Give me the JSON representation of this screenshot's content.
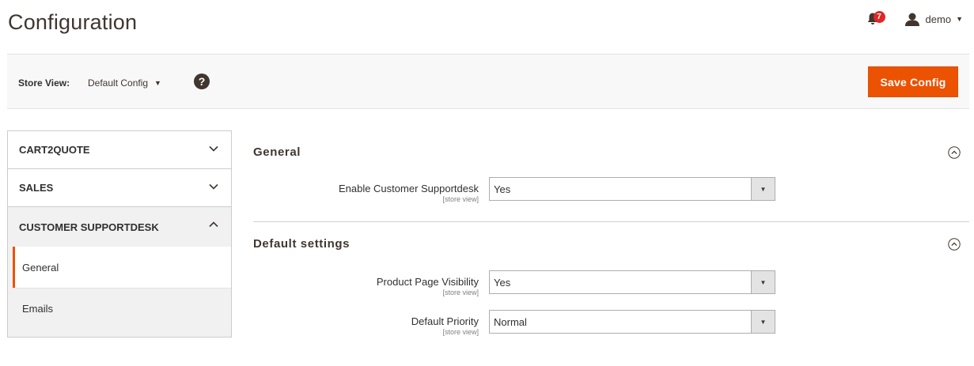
{
  "page": {
    "title": "Configuration"
  },
  "header": {
    "notifications_count": "7",
    "user_name": "demo"
  },
  "store_view": {
    "label": "Store View:",
    "value": "Default Config",
    "help": "?"
  },
  "actions": {
    "save_label": "Save Config"
  },
  "sidebar": {
    "tabs": [
      {
        "label": "CART2QUOTE"
      },
      {
        "label": "SALES"
      },
      {
        "label": "CUSTOMER SUPPORTDESK"
      }
    ],
    "subitems": [
      {
        "label": "General"
      },
      {
        "label": "Emails"
      }
    ]
  },
  "sections": [
    {
      "title": "General",
      "fields": [
        {
          "label": "Enable Customer Supportdesk",
          "scope": "[store view]",
          "value": "Yes"
        }
      ]
    },
    {
      "title": "Default settings",
      "fields": [
        {
          "label": "Product Page Visibility",
          "scope": "[store view]",
          "value": "Yes"
        },
        {
          "label": "Default Priority",
          "scope": "[store view]",
          "value": "Normal"
        }
      ]
    }
  ],
  "colors": {
    "accent": "#eb5202",
    "badge": "#e22626",
    "text": "#303030",
    "sidebar_bg": "#f1f1f1"
  },
  "icons": {
    "notifications": "bell-icon",
    "user": "user-icon",
    "help": "help-icon",
    "collapsed": "chevron-down-icon",
    "expanded": "chevron-up-icon",
    "section_toggle": "circle-chevron-up-icon"
  }
}
